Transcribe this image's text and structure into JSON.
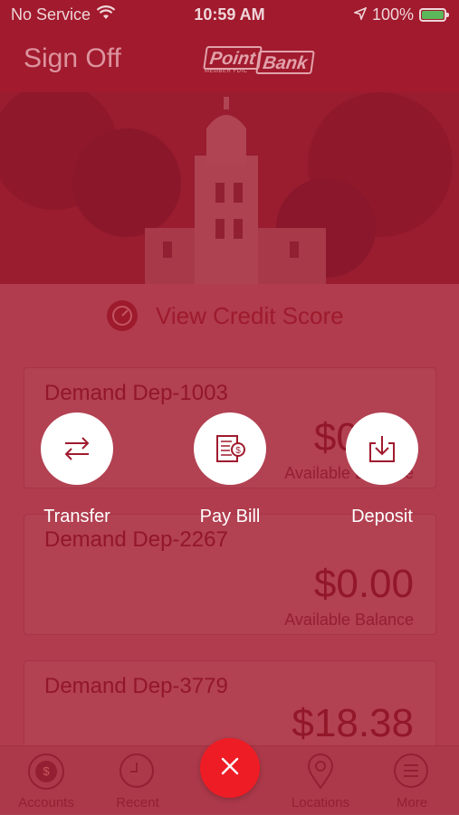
{
  "status_bar": {
    "carrier": "No Service",
    "time": "10:59 AM",
    "battery": "100%",
    "battery_level": 1.0,
    "wifi_icon": "wifi-icon",
    "location_icon": "location-arrow-icon"
  },
  "header": {
    "sign_off_label": "Sign Off",
    "logo": {
      "word1": "Point",
      "word2": "Bank",
      "small_text": "MEMBER FDIC"
    }
  },
  "credit": {
    "label": "View Credit Score",
    "icon": "gauge-icon"
  },
  "accounts": [
    {
      "name": "Demand Dep-1003",
      "amount": "$0.00",
      "balance_label": "Available Balance"
    },
    {
      "name": "Demand Dep-2267",
      "amount": "$0.00",
      "balance_label": "Available Balance"
    },
    {
      "name": "Demand Dep-3779",
      "amount": "$18.38",
      "balance_label": ""
    }
  ],
  "quick_actions": [
    {
      "label": "Transfer",
      "icon": "transfer-arrows-icon"
    },
    {
      "label": "Pay Bill",
      "icon": "bill-icon"
    },
    {
      "label": "Deposit",
      "icon": "deposit-tray-icon"
    }
  ],
  "tab_bar": [
    {
      "label": "Accounts",
      "icon": "dollar-icon"
    },
    {
      "label": "Recent",
      "icon": "clock-icon"
    },
    {
      "label": "Locations",
      "icon": "map-pin-icon"
    },
    {
      "label": "More",
      "icon": "menu-icon"
    }
  ],
  "close_button": {
    "icon": "close-icon"
  },
  "colors": {
    "brand_red": "#a01a2d",
    "close_red": "#ee1c25",
    "battery_green": "#4cd964"
  }
}
